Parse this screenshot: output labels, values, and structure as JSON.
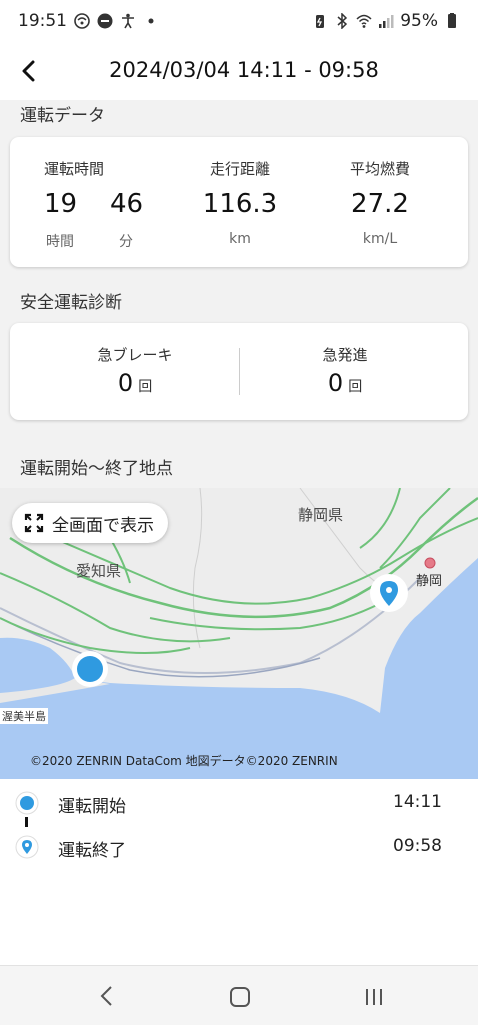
{
  "status_bar": {
    "time": "19:51",
    "battery": "95%",
    "icons": [
      "wifi-calling-icon",
      "do-not-disturb-icon",
      "accessibility-icon",
      "dot-icon",
      "battery-saver-icon",
      "bluetooth-icon",
      "wifi-icon",
      "signal-icon",
      "battery-icon"
    ]
  },
  "header": {
    "title": "2024/03/04 14:11 - 09:58"
  },
  "driving_data": {
    "section_title": "運転データ",
    "time_label": "運転時間",
    "hours": "19",
    "minutes": "46",
    "hours_unit": "時間",
    "minutes_unit": "分",
    "distance_label": "走行距離",
    "distance": "116.3",
    "distance_unit": "km",
    "fuel_label": "平均燃費",
    "fuel": "27.2",
    "fuel_unit": "km/L"
  },
  "safety": {
    "section_title": "安全運転診断",
    "brake_label": "急ブレーキ",
    "brake_count": "0",
    "accel_label": "急発進",
    "accel_count": "0",
    "count_unit": "回"
  },
  "map": {
    "section_title": "運転開始〜終了地点",
    "fullscreen_label": "全画面で表示",
    "labels": {
      "shizuoka_pref": "静岡県",
      "aichi_pref": "愛知県",
      "shizuoka_city": "静岡",
      "atsumi": "渥美半島"
    },
    "copyright": "©2020 ZENRIN DataCom 地図データ©2020 ZENRIN",
    "colors": {
      "sea": "#a9c9f3",
      "land": "#ededed",
      "road": "#6fc27a",
      "marker": "#2f9ae0"
    }
  },
  "points": {
    "start_label": "運転開始",
    "start_time": "14:11",
    "end_label": "運転終了",
    "end_time": "09:58"
  }
}
